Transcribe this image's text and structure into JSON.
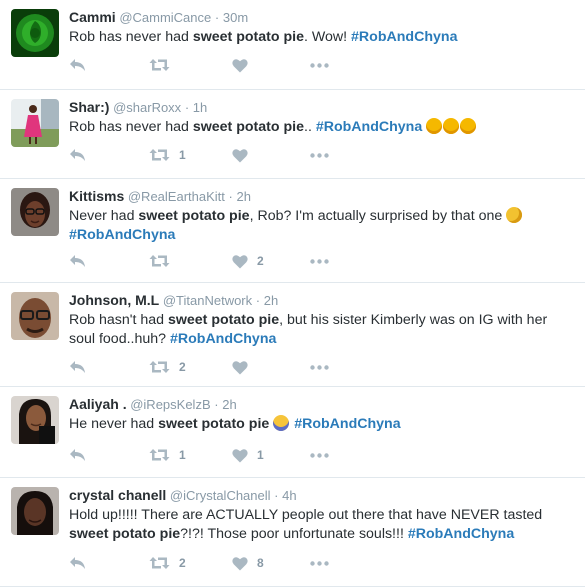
{
  "tweets": [
    {
      "name": "Cammi",
      "handle": "@CammiCance",
      "sep": "·",
      "time": "30m",
      "text": [
        {
          "t": "Rob has never had "
        },
        {
          "t": "sweet potato pie",
          "b": 1
        },
        {
          "t": ". Wow!  "
        },
        {
          "t": "#RobAndChyna",
          "tag": 1
        }
      ],
      "emojis": [],
      "retweets": "",
      "likes": "",
      "avatar": "green-rose"
    },
    {
      "name": "Shar:)",
      "handle": "@sharRoxx",
      "sep": "·",
      "time": "1h",
      "text": [
        {
          "t": "Rob has never had "
        },
        {
          "t": "sweet potato pie",
          "b": 1
        },
        {
          "t": ".. "
        },
        {
          "t": "#RobAndChyna",
          "tag": 1
        },
        {
          "t": " "
        }
      ],
      "emojis": [
        "sleepy-face-emoji",
        "sleepy-face-emoji",
        "sleepy-face-emoji"
      ],
      "retweets": "1",
      "likes": "",
      "avatar": "woman-pink-dress"
    },
    {
      "name": "Kittisms",
      "handle": "@RealEarthaKitt",
      "sep": "·",
      "time": "2h",
      "text": [
        {
          "t": "Never had "
        },
        {
          "t": "sweet potato pie",
          "b": 1
        },
        {
          "t": ", Rob? I'm actually surprised by that one "
        }
      ],
      "text2": [
        {
          "t": "#RobAndChyna",
          "tag": 1
        }
      ],
      "emojis": [
        "thinking-face-emoji"
      ],
      "retweets": "",
      "likes": "2",
      "avatar": "woman-glasses"
    },
    {
      "name": "Johnson, M.L",
      "handle": "@TitanNetwork",
      "sep": "·",
      "time": "2h",
      "text": [
        {
          "t": "Rob hasn't had "
        },
        {
          "t": "sweet potato pie",
          "b": 1
        },
        {
          "t": ", but his sister Kimberly was on IG with her"
        }
      ],
      "text2": [
        {
          "t": "soul food..huh? "
        },
        {
          "t": "#RobAndChyna",
          "tag": 1
        }
      ],
      "emojis": [],
      "retweets": "2",
      "likes": "",
      "avatar": "man-glasses"
    },
    {
      "name": "Aaliyah .",
      "handle": "@iRepsKelzB",
      "sep": "·",
      "time": "2h",
      "text": [
        {
          "t": "He never had "
        },
        {
          "t": "sweet potato pie",
          "b": 1
        },
        {
          "t": " "
        }
      ],
      "text_after": [
        {
          "t": " "
        },
        {
          "t": "#RobAndChyna",
          "tag": 1
        }
      ],
      "emojis": [
        "screaming-face-emoji"
      ],
      "retweets": "1",
      "likes": "1",
      "avatar": "woman-selfie"
    },
    {
      "name": "crystal chanell",
      "handle": "@iCrystalChanell",
      "sep": "·",
      "time": "4h",
      "text": [
        {
          "t": "Hold up!!!!! There are ACTUALLY people out there that have NEVER tasted"
        }
      ],
      "text2": [
        {
          "t": "sweet potato pie",
          "b": 1
        },
        {
          "t": "?!?! Those poor unfortunate souls!!! "
        },
        {
          "t": "#RobAndChyna",
          "tag": 1
        }
      ],
      "emojis": [],
      "retweets": "2",
      "likes": "8",
      "avatar": "woman-dark-hair"
    }
  ],
  "colors": {
    "tag": "#2b7bb9",
    "muted": "#8899a6",
    "divider": "#e1e8ed",
    "icon": "#aab8c2"
  }
}
